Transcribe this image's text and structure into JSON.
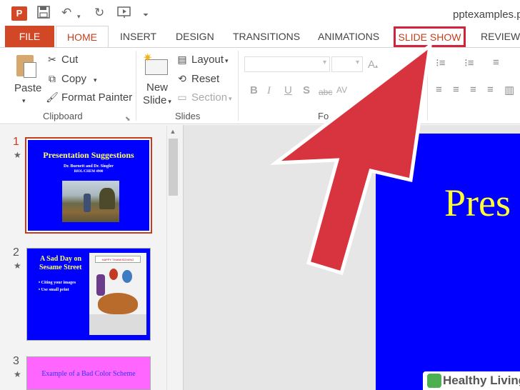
{
  "app": {
    "logo_letter": "P",
    "title": "pptexamples.p"
  },
  "qat": {
    "save": "save-icon",
    "undo": "undo-icon",
    "redo": "redo-icon",
    "from_beginning": "start-from-beginning-icon",
    "customize": "customize-qat-icon"
  },
  "tabs": {
    "file": "FILE",
    "home": "HOME",
    "insert": "INSERT",
    "design": "DESIGN",
    "transitions": "TRANSITIONS",
    "animations": "ANIMATIONS",
    "slideshow": "SLIDE SHOW",
    "review": "REVIEW"
  },
  "ribbon": {
    "clipboard": {
      "paste": "Paste",
      "cut": "Cut",
      "copy": "Copy",
      "format_painter": "Format Painter",
      "label": "Clipboard"
    },
    "slides": {
      "new_slide": "New",
      "new_slide_2": "Slide",
      "layout": "Layout",
      "reset": "Reset",
      "section": "Section",
      "label": "Slides"
    },
    "font": {
      "label": "Fo"
    }
  },
  "slides": [
    {
      "number": "1",
      "title": "Presentation Suggestions",
      "sub1": "Dr. Burnett and Dr. Singler",
      "sub2": "BIOL/CHEM 4900"
    },
    {
      "number": "2",
      "title1": "A Sad Day on",
      "title2": "Sesame Street",
      "bullet1": "Citing your images",
      "bullet2": "Use small print",
      "banner": "HAPPY THANKSGIVING"
    },
    {
      "number": "3",
      "title": "Example of a Bad Color Scheme"
    }
  ],
  "main_slide": {
    "title": "Pres"
  },
  "watermark": {
    "text": "Healthy Living"
  },
  "colors": {
    "accent": "#d24726",
    "highlight_box": "#d1233c",
    "arrow": "#d8343f",
    "slide_bg": "#0000ff",
    "slide_title": "#ffff33",
    "bad_scheme_bg": "#ff66ff"
  }
}
